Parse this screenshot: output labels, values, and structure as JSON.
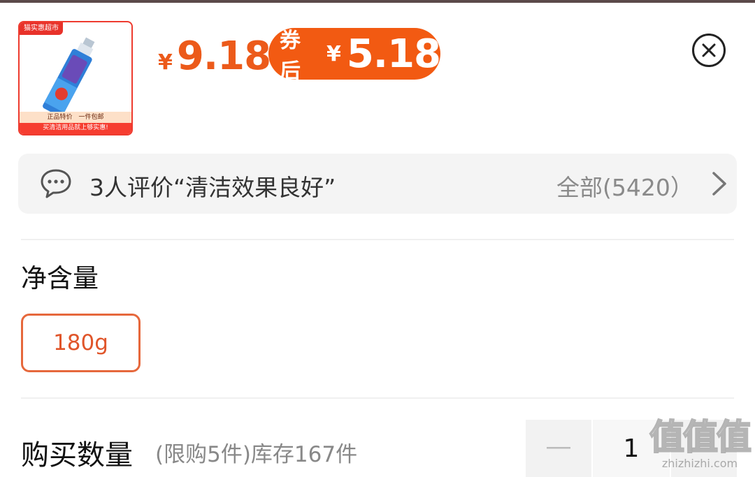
{
  "product": {
    "thumb_tag": "猫实惠超市",
    "thumb_line1": "正品特价　一件包邮",
    "thumb_line2": "买清洁用品就上够实惠!"
  },
  "price": {
    "currency": "¥",
    "original": "9.18",
    "coupon_label": "券后",
    "coupon_currency": "¥",
    "coupon_price": "5.18"
  },
  "review": {
    "summary": "3人评价“清洁效果良好”",
    "all_label": "全部(5420）"
  },
  "spec": {
    "title": "净含量",
    "options": [
      "180g"
    ],
    "selected": "180g"
  },
  "quantity": {
    "title": "购买数量",
    "note": "(限购5件)库存167件",
    "minus": "—",
    "value": "1"
  },
  "watermark": {
    "big": "值值值",
    "small": "zhizhizhi.com"
  },
  "colors": {
    "accent": "#F25A12",
    "price": "#EC5A1A",
    "spec_border": "#E6683C"
  }
}
